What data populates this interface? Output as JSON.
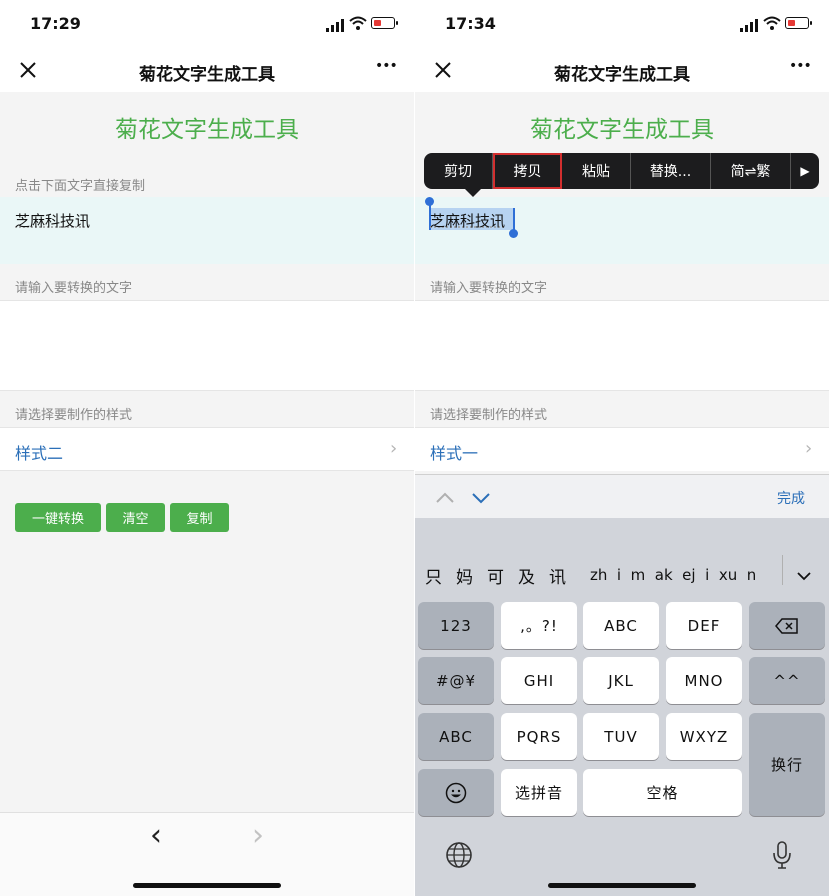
{
  "left": {
    "status": {
      "time": "17:29"
    },
    "nav": {
      "title": "菊花文字生成工具",
      "more": "•••"
    },
    "banner_title": "菊花文字生成工具",
    "result": {
      "label": "点击下面文字直接复制",
      "text": "芝麻科技讯"
    },
    "input": {
      "label": "请输入要转换的文字",
      "value": ""
    },
    "style": {
      "label": "请选择要制作的样式",
      "value": "样式二"
    },
    "buttons": {
      "convert": "一键转换",
      "clear": "清空",
      "copy": "复制"
    },
    "bottom_nav": {
      "back": "‹",
      "forward": "›"
    }
  },
  "right": {
    "status": {
      "time": "17:34"
    },
    "nav": {
      "title": "菊花文字生成工具",
      "more": "•••"
    },
    "banner_title": "菊花文字生成工具",
    "context_menu": {
      "items": [
        "剪切",
        "拷贝",
        "粘贴",
        "替换...",
        "简⇌繁"
      ],
      "more": "▶",
      "highlighted": "拷贝"
    },
    "result": {
      "text": "芝麻科技讯"
    },
    "input": {
      "label": "请输入要转换的文字"
    },
    "style": {
      "label": "请选择要制作的样式",
      "value": "样式一"
    },
    "keyboard_toolbar": {
      "done": "完成"
    },
    "candidates": {
      "words": [
        "只",
        "妈",
        "可",
        "及",
        "讯"
      ],
      "pinyin": "zh  i  m  ak  ej  i  xu  n"
    },
    "keys": {
      "row1": [
        "123",
        ",。?!",
        "ABC",
        "DEF"
      ],
      "row2": [
        "#@¥",
        "GHI",
        "JKL",
        "MNO",
        "^^"
      ],
      "row3": [
        "ABC",
        "PQRS",
        "TUV",
        "WXYZ"
      ],
      "row4": [
        "选拼音",
        "空格"
      ],
      "return": "换行"
    }
  },
  "colors": {
    "accent_green": "#4cae4c",
    "link_blue": "#2b6fb8",
    "highlight_red": "#d32f2f",
    "menu_bg": "#1c1c1e"
  }
}
